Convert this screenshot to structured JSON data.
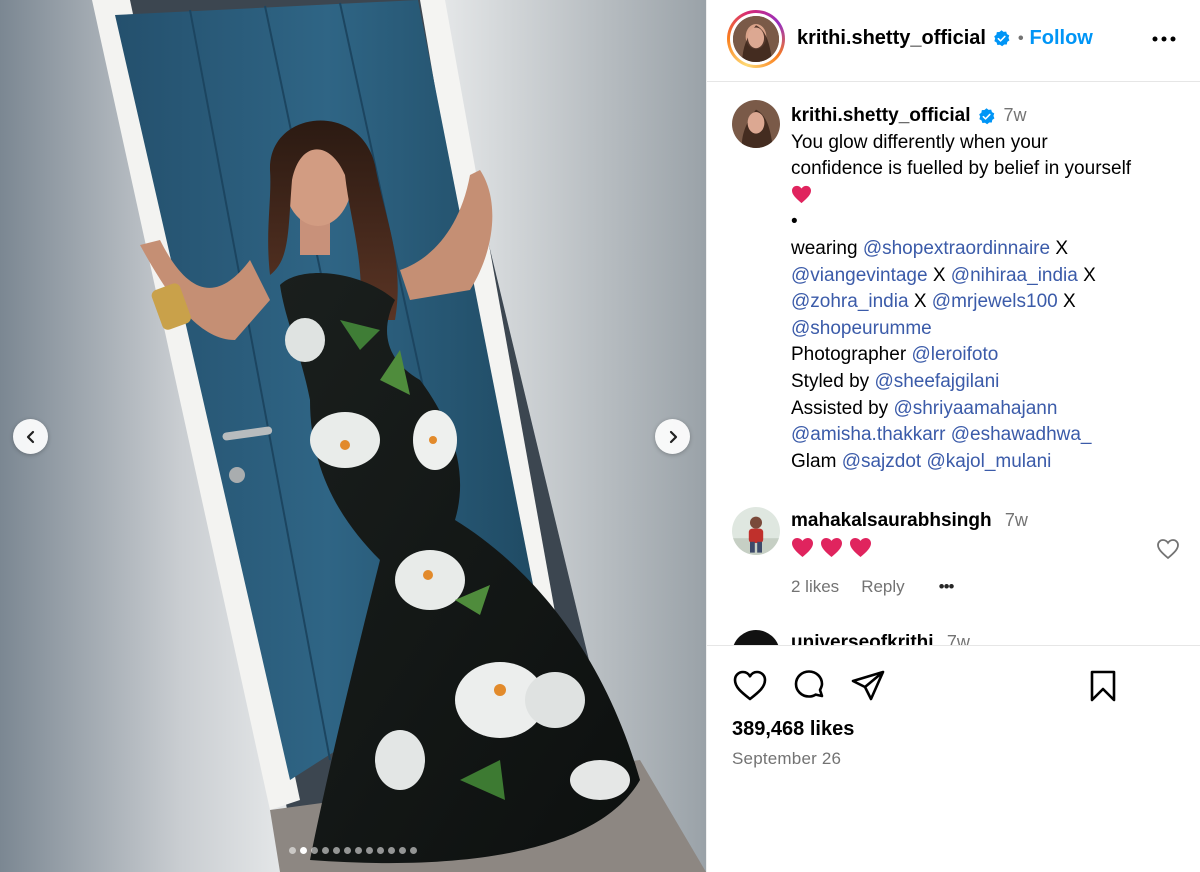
{
  "post": {
    "carousel": {
      "slide_count": 12,
      "active_index": 1,
      "prev_label": "Previous",
      "next_label": "Next"
    },
    "header": {
      "username": "krithi.shetty_official",
      "separator": "•",
      "follow_label": "Follow"
    },
    "caption": {
      "username": "krithi.shetty_official",
      "time": "7w",
      "line1": "You glow differently when your",
      "line2": "confidence is fuelled by belief in yourself",
      "bullet": "•",
      "wearing": "wearing",
      "m_shopextra": "@shopextraordinnaire",
      "x1": "X",
      "m_viange": "@viangevintage",
      "x2": "X",
      "m_nihiraa": "@nihiraa_india",
      "x3": "X",
      "m_zohra": "@zohra_india",
      "x4": "X",
      "m_mrjewels": "@mrjewels100",
      "x5": "X",
      "m_shopeurumme": "@shopeurumme",
      "photographer": "Photographer",
      "m_leroifoto": "@leroifoto",
      "styled_by": "Styled by",
      "m_sheefaj": "@sheefajgilani",
      "assisted_by": "Assisted by",
      "m_shriyaa": "@shriyaamahajann",
      "m_amisha": "@amisha.thakkarr",
      "m_eshawadhwa": "@eshawadhwa_",
      "glam": "Glam",
      "m_sajzdot": "@sajzdot",
      "m_kajol": "@kajol_mulani"
    },
    "comments": [
      {
        "username": "mahakalsaurabhsingh",
        "time": "7w",
        "emoji_count": 3,
        "likes": "2 likes",
        "reply": "Reply",
        "more": "•••"
      },
      {
        "username": "universeofkrithi",
        "time": "7w"
      }
    ],
    "likes": "389,468 likes",
    "date": "September 26"
  },
  "colors": {
    "follow": "#0095f6",
    "mention": "#3b5ba9",
    "verified": "#0095f6",
    "heart": "#e0245e"
  },
  "icons": [
    "chevron-left-icon",
    "chevron-right-icon",
    "verified-badge-icon",
    "more-options-icon",
    "heart-icon",
    "comment-icon",
    "share-icon",
    "bookmark-icon"
  ]
}
